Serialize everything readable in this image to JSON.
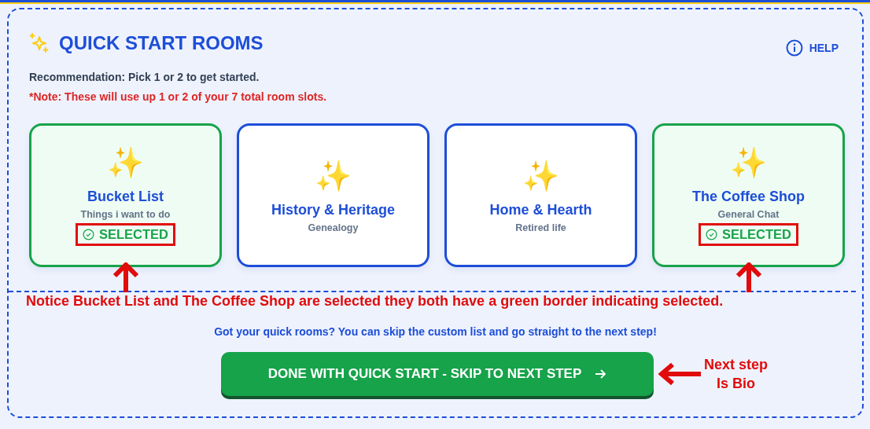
{
  "header": {
    "title": "QUICK START ROOMS",
    "help": "HELP"
  },
  "recommendation": "Recommendation: Pick 1 or 2 to get started.",
  "note": "*Note: These will use up 1 or 2 of your 7 total room slots.",
  "rooms": [
    {
      "icon": "✨",
      "title": "Bucket List",
      "subtitle": "Things i want to do",
      "selected": true,
      "badge": "SELECTED",
      "annotated": true
    },
    {
      "icon": "✨",
      "title": "History & Heritage",
      "subtitle": "Genealogy",
      "selected": false,
      "annotated": false
    },
    {
      "icon": "✨",
      "title": "Home & Hearth",
      "subtitle": "Retired life",
      "selected": false,
      "annotated": false
    },
    {
      "icon": "✨",
      "title": "The Coffee Shop",
      "subtitle": "General Chat",
      "selected": true,
      "badge": "SELECTED",
      "annotated": true
    }
  ],
  "annotation": "Notice Bucket List and The Coffee Shop are selected they both have a green border indicating selected.",
  "skip_hint": "Got your quick rooms? You can skip the custom list and go straight to the next step!",
  "done_button": "DONE WITH QUICK START - SKIP TO NEXT STEP",
  "side_note": [
    "Next step",
    "Is Bio"
  ]
}
